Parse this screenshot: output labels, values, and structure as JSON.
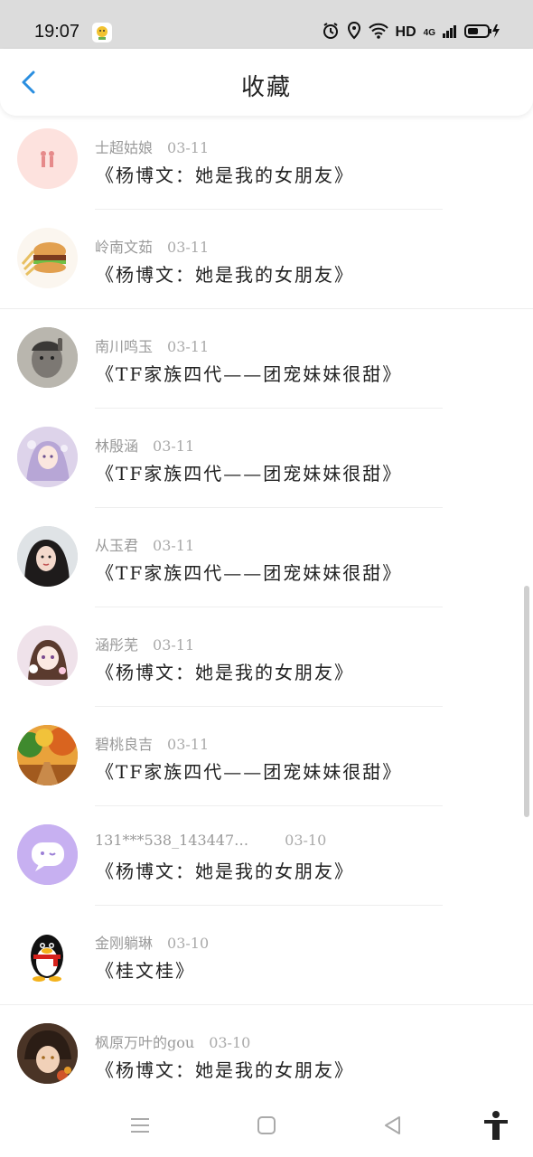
{
  "status_bar": {
    "time": "19:07",
    "network_label": "HD",
    "signal_label": "4G"
  },
  "header": {
    "title": "收藏",
    "back_icon": "chevron-left-icon"
  },
  "items": [
    {
      "author": "士超姑娘",
      "date": "03-11",
      "content": "《杨博文：她是我的女朋友》",
      "avatar_icon": "couple-avatar"
    },
    {
      "author": "岭南文茹",
      "date": "03-11",
      "content": "《杨博文：她是我的女朋友》",
      "avatar_icon": "burger-avatar"
    },
    {
      "author": "南川鸣玉",
      "date": "03-11",
      "content": "《TF家族四代——团宠妹妹很甜》",
      "avatar_icon": "boy-photo-avatar"
    },
    {
      "author": "林殷涵",
      "date": "03-11",
      "content": "《TF家族四代——团宠妹妹很甜》",
      "avatar_icon": "anime-girl-avatar"
    },
    {
      "author": "从玉君",
      "date": "03-11",
      "content": "《TF家族四代——团宠妹妹很甜》",
      "avatar_icon": "girl-photo-avatar"
    },
    {
      "author": "涵彤芜",
      "date": "03-11",
      "content": "《杨博文：她是我的女朋友》",
      "avatar_icon": "anime-girl-avatar"
    },
    {
      "author": "碧桃良吉",
      "date": "03-11",
      "content": "《TF家族四代——团宠妹妹很甜》",
      "avatar_icon": "autumn-trees-avatar"
    },
    {
      "author": "131***538_143447…",
      "date": "03-10",
      "content": "《杨博文：她是我的女朋友》",
      "avatar_icon": "chat-bubble-avatar"
    },
    {
      "author": "金刚躺琳",
      "date": "03-10",
      "content": "《桂文桂》",
      "avatar_icon": "penguin-avatar"
    },
    {
      "author": "枫原万叶的gou",
      "date": "03-10",
      "content": "《杨博文：她是我的女朋友》",
      "avatar_icon": "anime-boy-avatar"
    }
  ],
  "colors": {
    "accent": "#2a8ee0",
    "status_bar_bg": "#dcdcdc",
    "meta_text": "#9a9a9a",
    "content_text": "#222222"
  },
  "nav": {
    "menu_icon": "menu-icon",
    "home_icon": "home-square-icon",
    "back_icon": "back-triangle-icon",
    "accessibility_icon": "accessibility-icon"
  }
}
